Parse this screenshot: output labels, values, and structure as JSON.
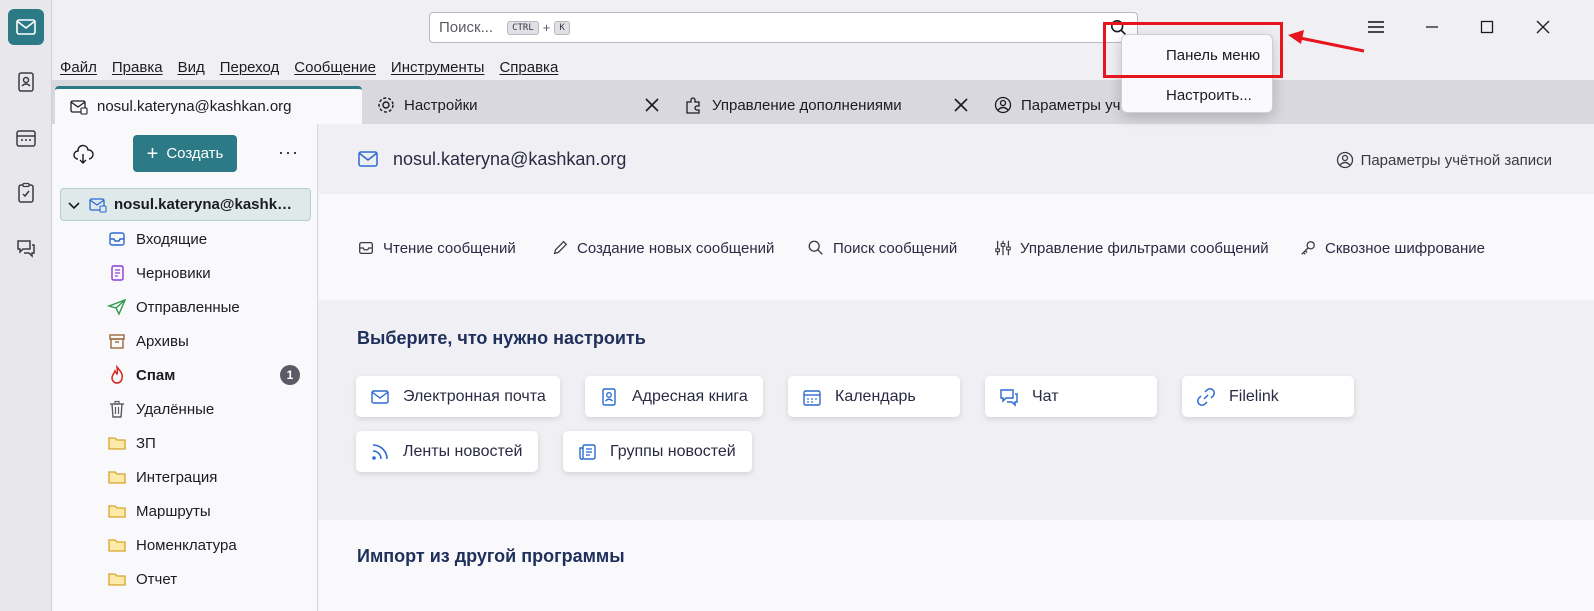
{
  "search": {
    "placeholder": "Поиск...",
    "key1": "CTRL",
    "plus": "+",
    "key2": "K"
  },
  "menubar": [
    "Файл",
    "Правка",
    "Вид",
    "Переход",
    "Сообщение",
    "Инструменты",
    "Справка"
  ],
  "tabs": [
    {
      "label": "nosul.kateryna@kashkan.org"
    },
    {
      "label": "Настройки"
    },
    {
      "label": "Управление дополнениями"
    },
    {
      "label": "Параметры учё"
    }
  ],
  "folderpane": {
    "new_button": "Создать",
    "more": "···",
    "account": "nosul.kateryna@kashkan.org",
    "folders": [
      {
        "label": "Входящие",
        "icon": "inbox-icon"
      },
      {
        "label": "Черновики",
        "icon": "drafts-icon"
      },
      {
        "label": "Отправленные",
        "icon": "sent-icon"
      },
      {
        "label": "Архивы",
        "icon": "archive-icon"
      },
      {
        "label": "Спам",
        "icon": "spam-icon",
        "badge": "1"
      },
      {
        "label": "Удалённые",
        "icon": "trash-icon"
      },
      {
        "label": "ЗП",
        "icon": "folder-icon"
      },
      {
        "label": "Интеграция",
        "icon": "folder-icon"
      },
      {
        "label": "Маршруты",
        "icon": "folder-icon"
      },
      {
        "label": "Номенклатура",
        "icon": "folder-icon"
      },
      {
        "label": "Отчет",
        "icon": "folder-icon"
      }
    ]
  },
  "content": {
    "account_title": "nosul.kateryna@kashkan.org",
    "account_settings": "Параметры учётной записи",
    "actions": [
      "Чтение сообщений",
      "Создание новых сообщений",
      "Поиск сообщений",
      "Управление фильтрами сообщений",
      "Сквозное шифрование"
    ],
    "setup_title": "Выберите, что нужно настроить",
    "cards": [
      "Электронная почта",
      "Адресная книга",
      "Календарь",
      "Чат",
      "Filelink",
      "Ленты новостей",
      "Группы новостей"
    ],
    "import_title": "Импорт из другой программы"
  },
  "popup": {
    "item1": "Панель меню",
    "item2": "Настроить..."
  },
  "colors": {
    "accent": "#2b7a86",
    "annotation": "#e8141e"
  }
}
